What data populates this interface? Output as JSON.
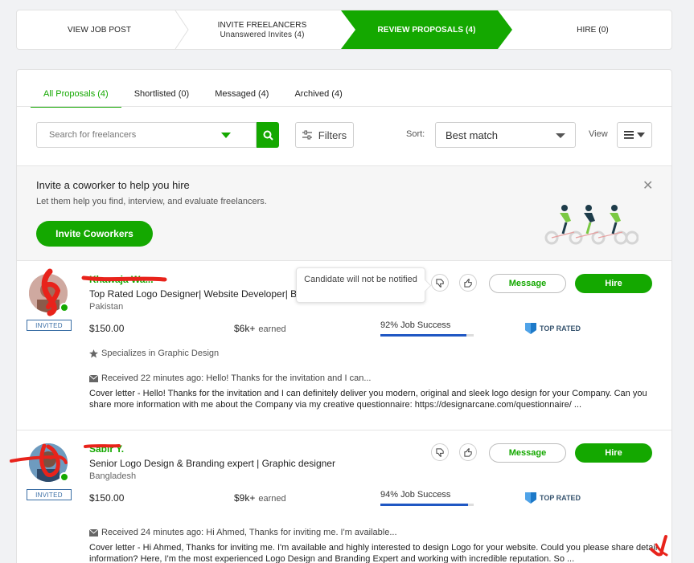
{
  "steps": [
    {
      "label": "VIEW JOB POST",
      "sub": ""
    },
    {
      "label": "INVITE FREELANCERS",
      "sub": "Unanswered Invites (4)"
    },
    {
      "label": "REVIEW PROPOSALS (4)",
      "sub": ""
    },
    {
      "label": "HIRE (0)",
      "sub": ""
    }
  ],
  "tabs": [
    {
      "label": "All Proposals (4)"
    },
    {
      "label": "Shortlisted (0)"
    },
    {
      "label": "Messaged (4)"
    },
    {
      "label": "Archived (4)"
    }
  ],
  "search": {
    "placeholder": "Search for freelancers"
  },
  "filters_label": "Filters",
  "sort": {
    "label": "Sort:",
    "value": "Best match"
  },
  "view_label": "View",
  "invite": {
    "title": "Invite a coworker to help you hire",
    "text": "Let them help you find, interview, and evaluate freelancers.",
    "button": "Invite Coworkers"
  },
  "tooltip": "Candidate will not be notified",
  "proposals": [
    {
      "name": "Khawaja Wa...",
      "title": "Top Rated Logo Designer| Website Developer| Br...",
      "country": "Pakistan",
      "badge": "INVITED",
      "rate": "$150.00",
      "earned": "$6k+",
      "earned_label": "earned",
      "jss": "92% Job Success",
      "jss_value": 0.92,
      "top_rated": "TOP RATED",
      "specializes": "Specializes in Graphic Design",
      "received": "Received 22 minutes ago: Hello! Thanks for the invitation and I can...",
      "cover_label": "Cover letter",
      "cover": " - Hello! Thanks for the invitation and I can definitely deliver you modern, original and sleek logo design for your Company. Can you share more information with me about the Company via my creative questionnaire: https://designarcane.com/questionnaire/ ...",
      "message_btn": "Message",
      "hire_btn": "Hire"
    },
    {
      "name": "Sabir Y.",
      "title": "Senior Logo Design & Branding expert | Graphic designer",
      "country": "Bangladesh",
      "badge": "INVITED",
      "rate": "$150.00",
      "earned": "$9k+",
      "earned_label": "earned",
      "jss": "94% Job Success",
      "jss_value": 0.94,
      "top_rated": "TOP RATED",
      "received": "Received 24 minutes ago: Hi Ahmed, Thanks for inviting me. I'm available...",
      "cover_label": "Cover letter",
      "cover": " - Hi Ahmed, Thanks for inviting me. I'm available and highly interested to design Logo for your website. Could you please share detail information? Here, I'm the most experienced Logo Design and Branding Expert and working with incredible reputation. So ...",
      "message_btn": "Message",
      "hire_btn": "Hire"
    }
  ],
  "colors": {
    "brand": "#14a800",
    "link_blue": "#1f57c3",
    "badge_blue": "#3a6ea5",
    "scribble": "#e8231b"
  }
}
